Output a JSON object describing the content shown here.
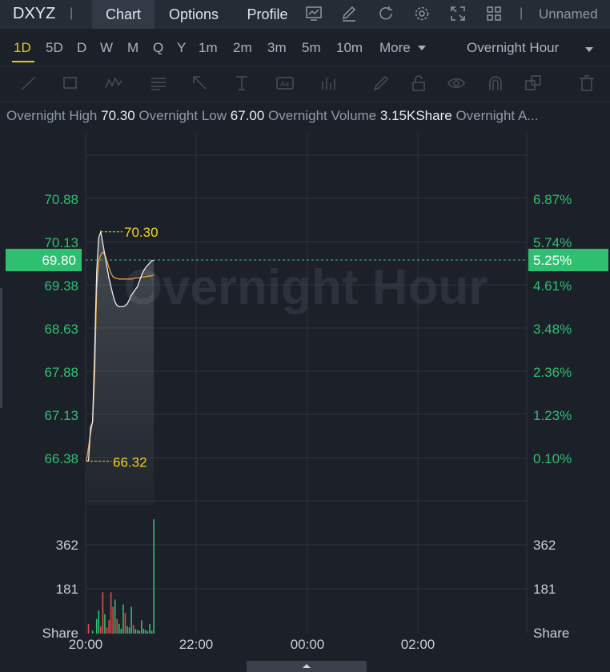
{
  "header": {
    "ticker": "DXYZ",
    "tabs": [
      {
        "label": "Chart",
        "active": true
      },
      {
        "label": "Options",
        "active": false
      },
      {
        "label": "Profile",
        "active": false
      }
    ],
    "icons": [
      "chart-icon",
      "pencil-icon",
      "refresh-icon",
      "settings-icon",
      "fullscreen-icon",
      "grid-layout-icon"
    ],
    "layout_name": "Unnamed"
  },
  "timeframes": {
    "items": [
      "1D",
      "5D",
      "D",
      "W",
      "M",
      "Q",
      "Y",
      "1m",
      "2m",
      "3m",
      "5m",
      "10m"
    ],
    "active": "1D",
    "more_label": "More",
    "session_label": "Overnight Hour"
  },
  "drawing_tools": [
    "trend-line-icon",
    "rectangle-icon",
    "pattern-icon",
    "fib-icon",
    "arrow-icon",
    "text-tool-icon",
    "label-icon",
    "bar-pattern-icon",
    "brush-icon",
    "lock-icon",
    "eye-icon",
    "magnet-icon",
    "copy-icon",
    "trash-icon"
  ],
  "stats": {
    "high_label": "Overnight High",
    "high_value": "70.30",
    "low_label": "Overnight Low",
    "low_value": "67.00",
    "volume_label": "Overnight Volume",
    "volume_value": "3.15KShare",
    "avg_label": "Overnight A..."
  },
  "chart_data": {
    "type": "line",
    "watermark": "Overnight Hour",
    "price_ticks": [
      "70.88",
      "70.13",
      "69.38",
      "68.63",
      "67.88",
      "67.13",
      "66.38"
    ],
    "percent_ticks": [
      "6.87%",
      "5.74%",
      "4.61%",
      "3.48%",
      "2.36%",
      "1.23%",
      "0.10%"
    ],
    "volume_ticks": [
      "362",
      "181"
    ],
    "volume_unit": "Share",
    "x_ticks": [
      "20:00",
      "22:00",
      "00:00",
      "02:00"
    ],
    "current_price": "69.80",
    "current_percent": "5.25%",
    "high_marker": "70.30",
    "low_marker": "66.32",
    "ylim": [
      66.38,
      70.88
    ],
    "price_series": [
      [
        0,
        66.32
      ],
      [
        1,
        66.32
      ],
      [
        2,
        66.9
      ],
      [
        3,
        67.0
      ],
      [
        4,
        68.2
      ],
      [
        5,
        69.6
      ],
      [
        6,
        70.2
      ],
      [
        7,
        70.3
      ],
      [
        8,
        70.1
      ],
      [
        9,
        69.9
      ],
      [
        10,
        69.7
      ],
      [
        11,
        69.5
      ],
      [
        12,
        69.35
      ],
      [
        13,
        69.2
      ],
      [
        14,
        69.08
      ],
      [
        15,
        69.02
      ],
      [
        16,
        69.0
      ],
      [
        17,
        69.0
      ],
      [
        18,
        69.0
      ],
      [
        19,
        69.02
      ],
      [
        20,
        69.05
      ],
      [
        21,
        69.12
      ],
      [
        22,
        69.2
      ],
      [
        23,
        69.25
      ],
      [
        24,
        69.3
      ],
      [
        25,
        69.35
      ],
      [
        26,
        69.45
      ],
      [
        27,
        69.55
      ],
      [
        28,
        69.62
      ],
      [
        29,
        69.68
      ],
      [
        30,
        69.72
      ],
      [
        31,
        69.76
      ],
      [
        32,
        69.8
      ],
      [
        33,
        69.8
      ]
    ],
    "avg_series": [
      [
        0,
        66.32
      ],
      [
        2,
        66.8
      ],
      [
        3,
        67.0
      ],
      [
        4,
        67.8
      ],
      [
        5,
        69.3
      ],
      [
        6,
        69.8
      ],
      [
        7,
        69.9
      ],
      [
        8,
        69.95
      ],
      [
        9,
        69.9
      ],
      [
        10,
        69.8
      ],
      [
        11,
        69.68
      ],
      [
        12,
        69.58
      ],
      [
        13,
        69.52
      ],
      [
        14,
        69.5
      ],
      [
        15,
        69.49
      ],
      [
        16,
        69.48
      ],
      [
        17,
        69.48
      ],
      [
        18,
        69.48
      ],
      [
        19,
        69.48
      ],
      [
        20,
        69.48
      ],
      [
        21,
        69.48
      ],
      [
        22,
        69.48
      ],
      [
        23,
        69.49
      ],
      [
        24,
        69.5
      ],
      [
        25,
        69.5
      ],
      [
        26,
        69.5
      ],
      [
        27,
        69.51
      ],
      [
        28,
        69.52
      ],
      [
        29,
        69.52
      ],
      [
        30,
        69.53
      ],
      [
        31,
        69.53
      ],
      [
        32,
        69.54
      ],
      [
        33,
        69.55
      ]
    ],
    "volume_series": [
      {
        "i": 1,
        "v": 40,
        "dir": "down"
      },
      {
        "i": 3,
        "v": 12,
        "dir": "up"
      },
      {
        "i": 5,
        "v": 60,
        "dir": "up"
      },
      {
        "i": 6,
        "v": 95,
        "dir": "up"
      },
      {
        "i": 7,
        "v": 30,
        "dir": "down"
      },
      {
        "i": 8,
        "v": 170,
        "dir": "down"
      },
      {
        "i": 9,
        "v": 80,
        "dir": "up"
      },
      {
        "i": 10,
        "v": 25,
        "dir": "down"
      },
      {
        "i": 11,
        "v": 55,
        "dir": "down"
      },
      {
        "i": 12,
        "v": 170,
        "dir": "down"
      },
      {
        "i": 13,
        "v": 110,
        "dir": "down"
      },
      {
        "i": 14,
        "v": 140,
        "dir": "up"
      },
      {
        "i": 15,
        "v": 60,
        "dir": "down"
      },
      {
        "i": 16,
        "v": 40,
        "dir": "up"
      },
      {
        "i": 17,
        "v": 20,
        "dir": "up"
      },
      {
        "i": 18,
        "v": 120,
        "dir": "up"
      },
      {
        "i": 19,
        "v": 85,
        "dir": "down"
      },
      {
        "i": 20,
        "v": 30,
        "dir": "up"
      },
      {
        "i": 21,
        "v": 25,
        "dir": "up"
      },
      {
        "i": 22,
        "v": 110,
        "dir": "up"
      },
      {
        "i": 23,
        "v": 35,
        "dir": "down"
      },
      {
        "i": 24,
        "v": 18,
        "dir": "up"
      },
      {
        "i": 25,
        "v": 15,
        "dir": "up"
      },
      {
        "i": 26,
        "v": 12,
        "dir": "up"
      },
      {
        "i": 27,
        "v": 55,
        "dir": "up"
      },
      {
        "i": 28,
        "v": 20,
        "dir": "up"
      },
      {
        "i": 29,
        "v": 15,
        "dir": "up"
      },
      {
        "i": 30,
        "v": 10,
        "dir": "up"
      },
      {
        "i": 31,
        "v": 40,
        "dir": "up"
      },
      {
        "i": 32,
        "v": 12,
        "dir": "up"
      },
      {
        "i": 33,
        "v": 470,
        "dir": "up"
      }
    ],
    "colors": {
      "price_line": "#e8edf2",
      "avg_line": "#e9a13b",
      "axis_green": "#2fbf71",
      "marker_yellow": "#f1d21a",
      "vol_up": "#2fbf71",
      "vol_down": "#e04e4e",
      "grid": "#2c333d"
    }
  }
}
